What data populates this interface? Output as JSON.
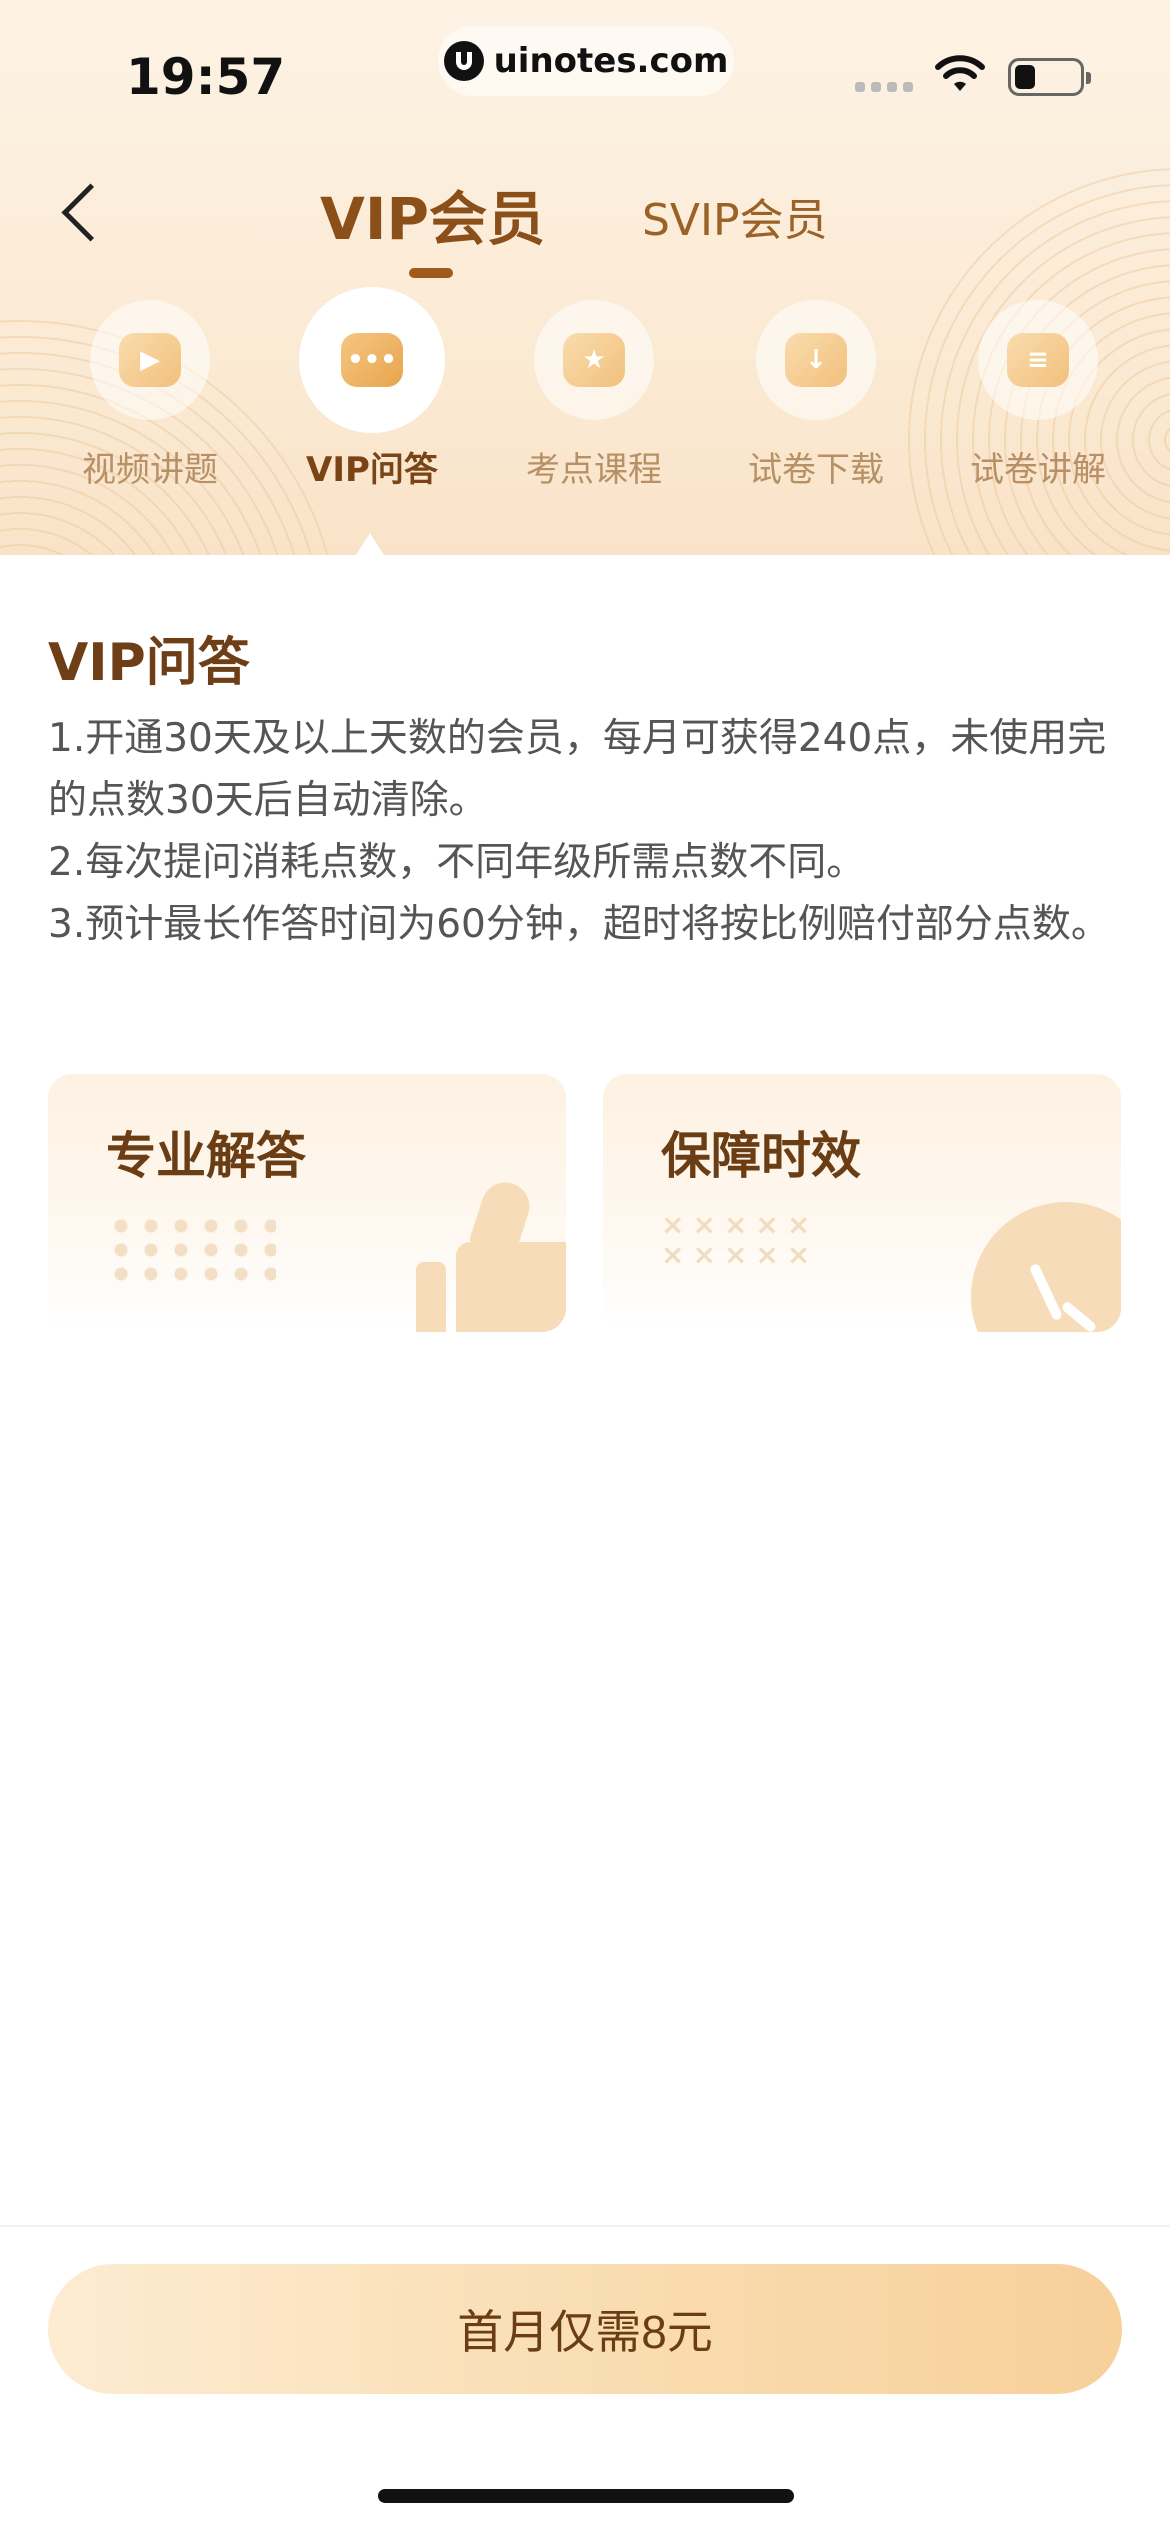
{
  "status_bar": {
    "time": "19:57",
    "url": "uinotes.com"
  },
  "nav": {
    "tabs": [
      {
        "label": "VIP会员",
        "active": true
      },
      {
        "label": "SVIP会员",
        "active": false
      }
    ]
  },
  "features": [
    {
      "label": "视频讲题",
      "icon": "video-icon",
      "active": false
    },
    {
      "label": "VIP问答",
      "icon": "chat-bubble-icon",
      "active": true
    },
    {
      "label": "考点课程",
      "icon": "star-bulb-icon",
      "active": false
    },
    {
      "label": "试卷下载",
      "icon": "download-box-icon",
      "active": false
    },
    {
      "label": "试卷讲解",
      "icon": "document-icon",
      "active": false
    }
  ],
  "section": {
    "title": "VIP问答",
    "items": [
      "1.开通30天及以上天数的会员，每月可获得240点，未使用完的点数30天后自动清除。",
      "2.每次提问消耗点数，不同年级所需点数不同。",
      "3.预计最长作答时间为60分钟，超时将按比例赔付部分点数。"
    ]
  },
  "cards": [
    {
      "title": "专业解答",
      "icon": "thumbs-up-icon"
    },
    {
      "title": "保障时效",
      "icon": "clock-icon"
    }
  ],
  "cta": {
    "label": "首月仅需8元"
  },
  "colors": {
    "accent": "#8b4f1a",
    "header_bg": "#fbe9d2",
    "cta_gradient_end": "#f7d09a"
  }
}
